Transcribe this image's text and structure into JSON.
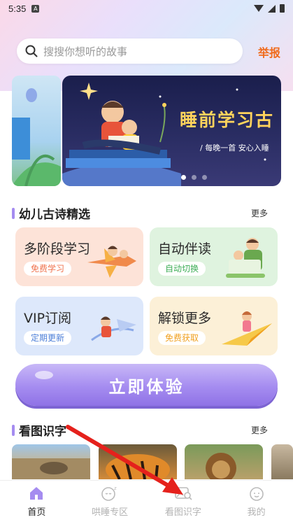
{
  "status": {
    "time": "5:35",
    "notification_glyph": "A"
  },
  "search": {
    "placeholder": "搜搜你想听的故事",
    "report_label": "举报"
  },
  "banner": {
    "title": "睡前学习古",
    "subtitle": "/ 每晚一首 安心入睡",
    "active_dot": 0,
    "dot_count": 3
  },
  "section_poems": {
    "title": "幼儿古诗精选",
    "more": "更多"
  },
  "cards": [
    {
      "title": "多阶段学习",
      "badge": "免费学习",
      "bg": "#fde3d8",
      "badge_color": "#f0734e"
    },
    {
      "title": "自动伴读",
      "badge": "自动切换",
      "bg": "#dff3df",
      "badge_color": "#3fae58"
    },
    {
      "title": "VIP订阅",
      "badge": "定期更新",
      "bg": "#dde8fb",
      "badge_color": "#4d7fd8"
    },
    {
      "title": "解锁更多",
      "badge": "免费获取",
      "bg": "#fcf0d7",
      "badge_color": "#f0a020"
    }
  ],
  "cta": {
    "label": "立即体验"
  },
  "section_pictures": {
    "title": "看图识字",
    "more": "更多"
  },
  "tabs": [
    {
      "label": "首页",
      "icon": "home-icon",
      "active": true
    },
    {
      "label": "哄睡专区",
      "icon": "sleep-face-icon",
      "active": false
    },
    {
      "label": "看图识字",
      "icon": "image-search-icon",
      "active": false
    },
    {
      "label": "我的",
      "icon": "profile-face-icon",
      "active": false
    }
  ],
  "colors": {
    "accent": "#a58cf0",
    "report": "#f06b1c",
    "annotation_arrow": "#e5211c"
  }
}
